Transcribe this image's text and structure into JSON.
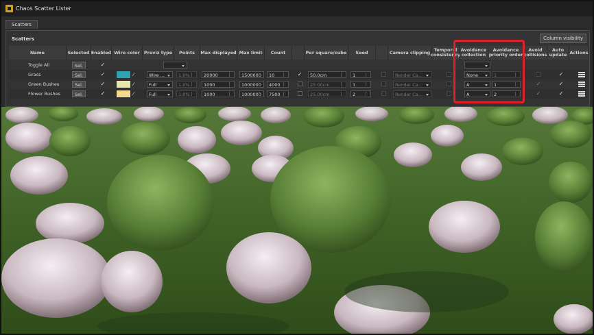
{
  "window": {
    "title": "Chaos Scatter Lister"
  },
  "tabs": [
    {
      "label": "Scatters"
    }
  ],
  "panel": {
    "label": "Scatters",
    "column_visibility_button": "Column visibility"
  },
  "headers": [
    "Name",
    "Selected",
    "Enabled",
    "Wire color",
    "Previz type",
    "Points",
    "Max displayed",
    "Max limit",
    "Count",
    "",
    "Per square/cube",
    "Seed",
    "",
    "Camera clipping",
    "Temporal consistency",
    "Avoidance collection",
    "Avoidance priority order",
    "Avoid collisions",
    "Auto update",
    "Actions"
  ],
  "rows": [
    {
      "name": "Toggle All",
      "sel": "Sel.",
      "enabled": "✓"
    },
    {
      "name": "Grass",
      "sel": "Sel.",
      "enabled": "✓",
      "wire_color": "#2fa3b4",
      "previz": "Wire ...",
      "points": "1.0%",
      "max_displayed": "20000",
      "max_limit": "1500000",
      "count": "10",
      "density_checked": "✓",
      "per_square": "50.0cm",
      "seed": "1",
      "camera_clipping": "Render Ca...",
      "avoidance_collection": "None",
      "priority": "1",
      "auto_update": "✓"
    },
    {
      "name": "Green Bushes",
      "sel": "Sel.",
      "enabled": "✓",
      "wire_color": "#e6e6ad",
      "previz": "Full",
      "points": "1.0%",
      "max_displayed": "1000",
      "max_limit": "1000000",
      "count": "4000",
      "per_square": "25.00cm",
      "seed": "1",
      "camera_clipping": "Render Ca...",
      "avoidance_collection": "A",
      "priority": "1",
      "avoid_collisions": "✓",
      "auto_update": "✓"
    },
    {
      "name": "Flower Bushes",
      "sel": "Sel.",
      "enabled": "✓",
      "wire_color": "#f2d98c",
      "previz": "Full",
      "points": "1.0%",
      "max_displayed": "1000",
      "max_limit": "1000000",
      "count": "7500",
      "per_square": "25.00cm",
      "seed": "2",
      "camera_clipping": "Render Ca...",
      "avoidance_collection": "A",
      "priority": "2",
      "avoid_collisions": "✓",
      "auto_update": "✓"
    }
  ],
  "icons": {
    "eyedropper": "eyedropper-icon",
    "actions": "hamburger-menu-icon"
  }
}
